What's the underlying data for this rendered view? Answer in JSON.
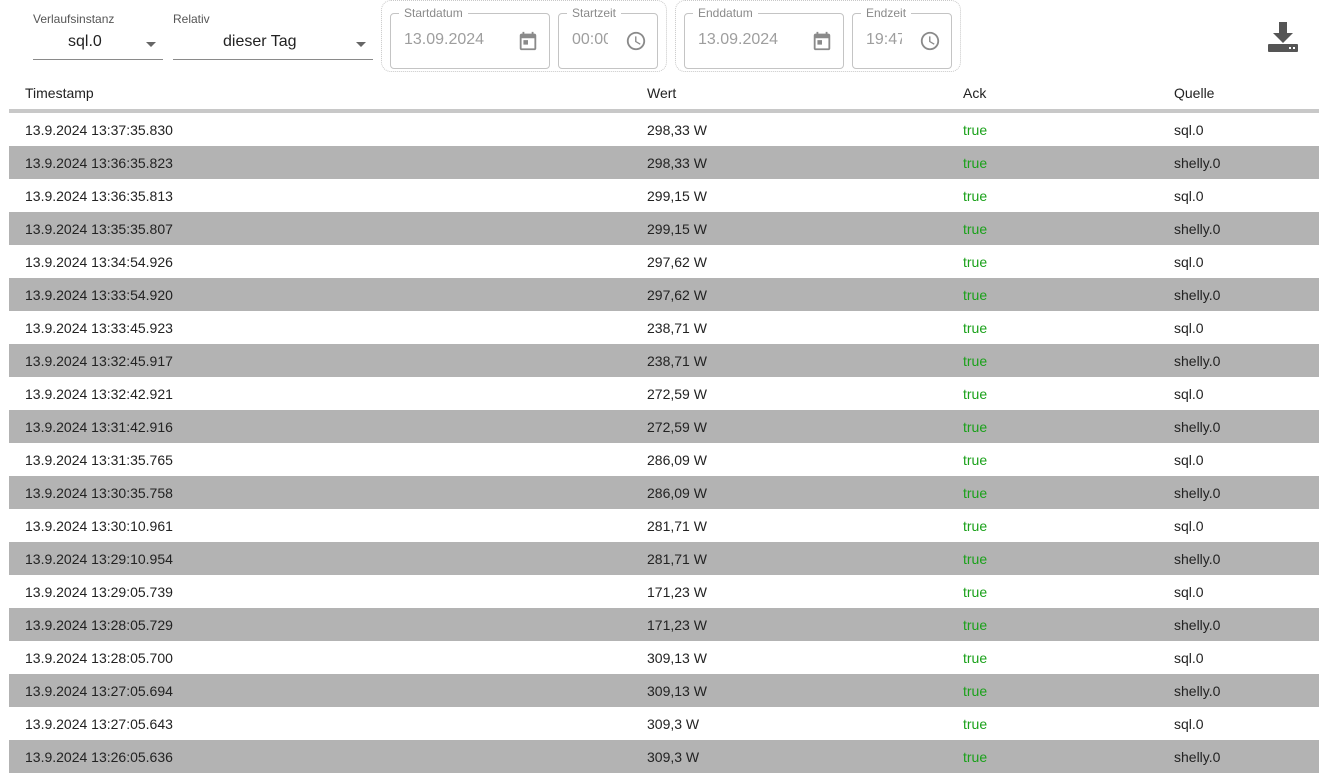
{
  "toolbar": {
    "instance": {
      "label": "Verlaufsinstanz",
      "value": "sql.0"
    },
    "relative": {
      "label": "Relativ",
      "value": "dieser Tag"
    },
    "start_date": {
      "label": "Startdatum",
      "value": "13.09.2024"
    },
    "start_time": {
      "label": "Startzeit",
      "value": "00:00"
    },
    "end_date": {
      "label": "Enddatum",
      "value": "13.09.2024"
    },
    "end_time": {
      "label": "Endzeit",
      "value": "19:47"
    },
    "download_icon": "download-icon"
  },
  "table": {
    "headers": [
      "Timestamp",
      "Wert",
      "Ack",
      "Quelle"
    ],
    "rows": [
      [
        "13.9.2024 13:37:35.830",
        "298,33 W",
        "true",
        "sql.0"
      ],
      [
        "13.9.2024 13:36:35.823",
        "298,33 W",
        "true",
        "shelly.0"
      ],
      [
        "13.9.2024 13:36:35.813",
        "299,15 W",
        "true",
        "sql.0"
      ],
      [
        "13.9.2024 13:35:35.807",
        "299,15 W",
        "true",
        "shelly.0"
      ],
      [
        "13.9.2024 13:34:54.926",
        "297,62 W",
        "true",
        "sql.0"
      ],
      [
        "13.9.2024 13:33:54.920",
        "297,62 W",
        "true",
        "shelly.0"
      ],
      [
        "13.9.2024 13:33:45.923",
        "238,71 W",
        "true",
        "sql.0"
      ],
      [
        "13.9.2024 13:32:45.917",
        "238,71 W",
        "true",
        "shelly.0"
      ],
      [
        "13.9.2024 13:32:42.921",
        "272,59 W",
        "true",
        "sql.0"
      ],
      [
        "13.9.2024 13:31:42.916",
        "272,59 W",
        "true",
        "shelly.0"
      ],
      [
        "13.9.2024 13:31:35.765",
        "286,09 W",
        "true",
        "sql.0"
      ],
      [
        "13.9.2024 13:30:35.758",
        "286,09 W",
        "true",
        "shelly.0"
      ],
      [
        "13.9.2024 13:30:10.961",
        "281,71 W",
        "true",
        "sql.0"
      ],
      [
        "13.9.2024 13:29:10.954",
        "281,71 W",
        "true",
        "shelly.0"
      ],
      [
        "13.9.2024 13:29:05.739",
        "171,23 W",
        "true",
        "sql.0"
      ],
      [
        "13.9.2024 13:28:05.729",
        "171,23 W",
        "true",
        "shelly.0"
      ],
      [
        "13.9.2024 13:28:05.700",
        "309,13 W",
        "true",
        "sql.0"
      ],
      [
        "13.9.2024 13:27:05.694",
        "309,13 W",
        "true",
        "shelly.0"
      ],
      [
        "13.9.2024 13:27:05.643",
        "309,3 W",
        "true",
        "sql.0"
      ],
      [
        "13.9.2024 13:26:05.636",
        "309,3 W",
        "true",
        "shelly.0"
      ]
    ]
  },
  "colors": {
    "ack_true": "#1aa11a",
    "row_alt": "#b3b3b3"
  }
}
